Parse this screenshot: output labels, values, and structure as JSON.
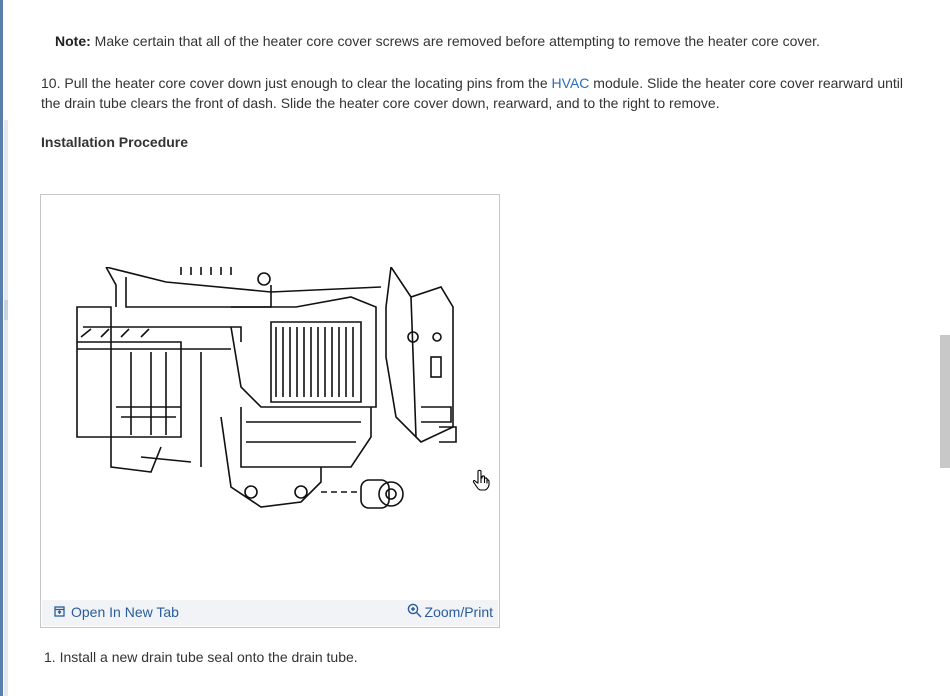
{
  "note": {
    "label": "Note:",
    "text": " Make certain that all of the heater core cover screws are removed before attempting to remove the heater core cover."
  },
  "step10": {
    "prefix": "10. Pull the heater core cover down just enough to clear the locating pins from the ",
    "link": "HVAC",
    "suffix": " module. Slide the heater core cover rearward until the drain tube clears the front of dash. Slide the heater core cover down, rearward, and to the right to remove."
  },
  "section_heading": "Installation Procedure",
  "figure": {
    "open_tab_label": "Open In New Tab",
    "zoom_label": "Zoom/Print",
    "icons": {
      "open": "open-in-new-tab-icon",
      "zoom": "zoom-in-icon"
    }
  },
  "step1": "1. Install a new drain tube seal onto the drain tube.",
  "colors": {
    "link": "#2a6ebb",
    "figure_bar": "#f1f3f6",
    "text": "#333333"
  }
}
